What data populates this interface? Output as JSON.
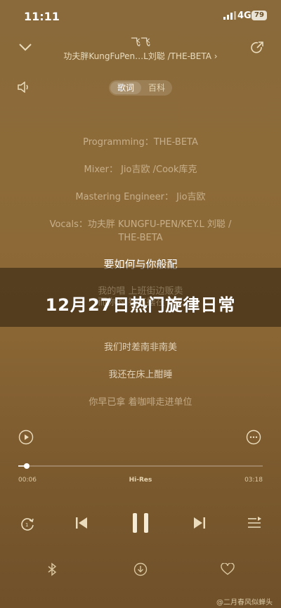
{
  "status_bar": {
    "time": "11:11",
    "network": "4G",
    "battery": "79"
  },
  "player": {
    "title": "飞飞",
    "artist": "功夫胖KungFuPen…L刘聪 /THE-BETA",
    "tabs": [
      {
        "label": "歌词",
        "selected": true
      },
      {
        "label": "百科",
        "selected": false
      }
    ]
  },
  "lyrics": [
    "Programming：THE-BETA",
    "Mixer： Jio吉欧 /Cook库克",
    "Mastering Engineer： Jio吉欧",
    "Vocals：功夫胖 KUNGFU-PEN/KEY.L 刘聪 /",
    "THE-BETA",
    "要如何与你般配",
    "我的唱 上班街边贩卖",
    "而你的 钻石摆在专柜",
    "我们时差南非南美",
    "我还在床上酣睡",
    "你早已拿 着咖啡走进单位"
  ],
  "banner": {
    "text": "12月27日热门旋律日常"
  },
  "progress": {
    "elapsed": "00:06",
    "total": "03:18",
    "quality": "Hi-Res",
    "fraction": 0.035
  },
  "watermark": "@二月春风似蝉头",
  "icons": [
    "chevron-down-icon",
    "share-icon",
    "volume-icon",
    "play-video-icon",
    "more-icon",
    "repeat-icon",
    "previous-icon",
    "pause-icon",
    "next-icon",
    "playlist-icon",
    "bluetooth-icon",
    "download-icon",
    "heart-icon",
    "signal-icon"
  ]
}
